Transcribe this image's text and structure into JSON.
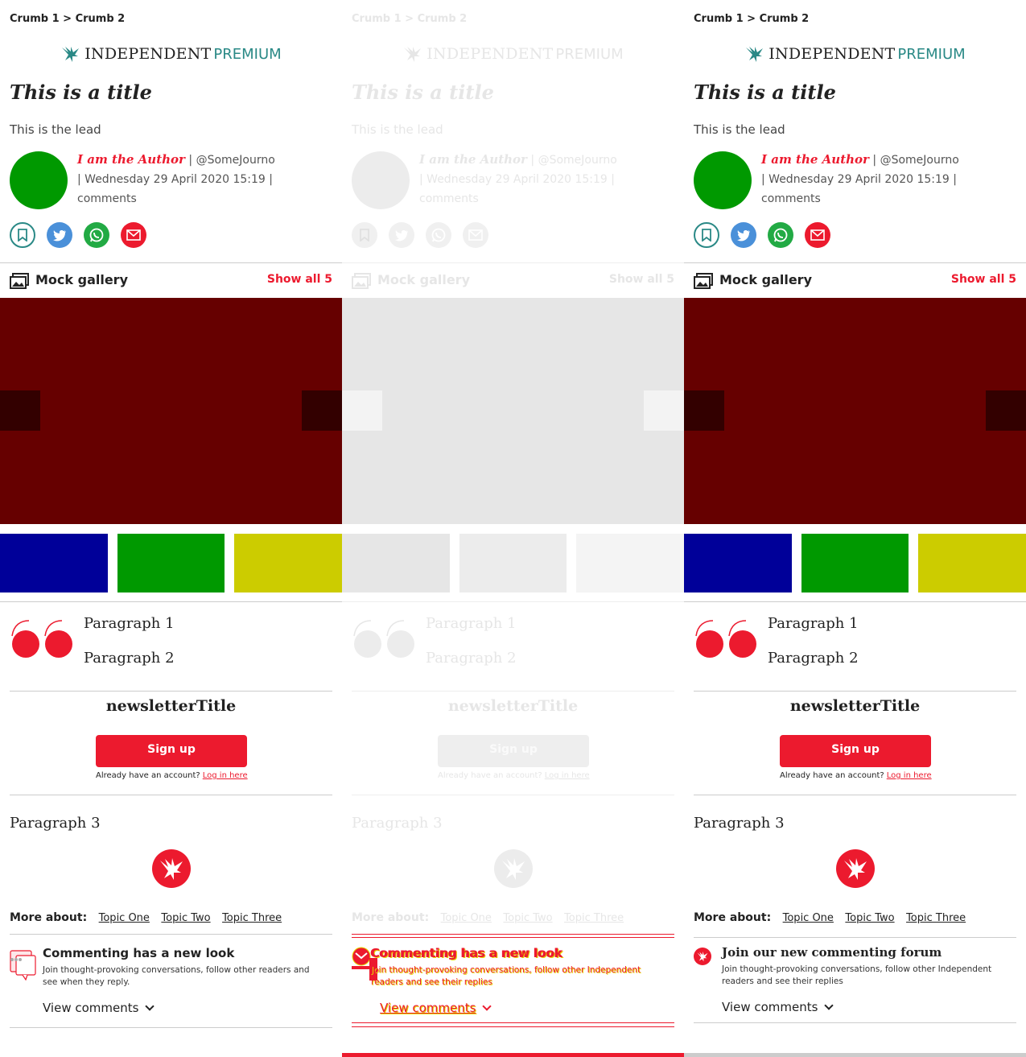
{
  "panels": [
    {
      "breadcrumb": "Crumb 1 > Crumb 2",
      "brand": {
        "name": "INDEPENDENT",
        "tier": "PREMIUM"
      },
      "title": "This is a title",
      "lead": "This is the lead",
      "byline": {
        "author": "I am the Author",
        "handle": "| @SomeJourno",
        "date": "| Wednesday 29 April 2020 15:19 |",
        "comments": "comments"
      },
      "gallery": {
        "title": "Mock gallery",
        "show_all": "Show all 5"
      },
      "paragraphs": [
        "Paragraph 1",
        "Paragraph 2",
        "Paragraph 3"
      ],
      "newsletter": {
        "title": "newsletterTitle",
        "signup": "Sign up",
        "account_text": "Already have an account?",
        "login": "Log in here"
      },
      "more_about": {
        "label": "More about:",
        "topics": [
          "Topic One",
          "Topic Two",
          "Topic Three"
        ]
      },
      "commenting": {
        "title": "Commenting has a new look",
        "desc": "Join thought-provoking conversations, follow other readers and see when they reply.",
        "link": "View comments"
      }
    },
    {
      "breadcrumb": "Crumb 1 > Crumb 2",
      "brand": {
        "name": "INDEPENDENT",
        "tier": "PREMIUM"
      },
      "title": "This is a title",
      "lead": "This is the lead",
      "byline": {
        "author": "I am the Author",
        "handle": "| @SomeJourno",
        "date": "| Wednesday 29 April 2020 15:19 |",
        "comments": "comments"
      },
      "gallery": {
        "title": "Mock gallery",
        "show_all": "Show all 5"
      },
      "paragraphs": [
        "Paragraph 1",
        "Paragraph 2",
        "Paragraph 3"
      ],
      "newsletter": {
        "title": "newsletterTitle",
        "signup": "Sign up",
        "account_text": "Already have an account?",
        "login": "Log in here"
      },
      "more_about": {
        "label": "More about:",
        "topics": [
          "Topic One",
          "Topic Two",
          "Topic Three"
        ]
      },
      "commenting": {
        "title": "Commenting has a new look",
        "desc": "Join thought-provoking conversations, follow other Independent readers and see their replies",
        "link": "View comments"
      }
    },
    {
      "breadcrumb": "Crumb 1 > Crumb 2",
      "brand": {
        "name": "INDEPENDENT",
        "tier": "PREMIUM"
      },
      "title": "This is a title",
      "lead": "This is the lead",
      "byline": {
        "author": "I am the Author",
        "handle": "| @SomeJourno",
        "date": "| Wednesday 29 April 2020 15:19 |",
        "comments": "comments"
      },
      "gallery": {
        "title": "Mock gallery",
        "show_all": "Show all 5"
      },
      "paragraphs": [
        "Paragraph 1",
        "Paragraph 2",
        "Paragraph 3"
      ],
      "newsletter": {
        "title": "newsletterTitle",
        "signup": "Sign up",
        "account_text": "Already have an account?",
        "login": "Log in here"
      },
      "more_about": {
        "label": "More about:",
        "topics": [
          "Topic One",
          "Topic Two",
          "Topic Three"
        ]
      },
      "commenting": {
        "title": "Join our new commenting forum",
        "desc": "Join thought-provoking conversations, follow other Independent readers and see their replies",
        "link": "View comments"
      }
    }
  ],
  "colors": {
    "accent": "#ec1a2e",
    "premium": "#2a8986",
    "gallery_bg": "#660000",
    "avatar": "#009900",
    "diff_marker": "#e6d800"
  },
  "icons": [
    "eagle-icon",
    "bookmark-icon",
    "twitter-icon",
    "whatsapp-icon",
    "email-icon",
    "gallery-icon",
    "quote-icon",
    "chevron-down-icon",
    "comment-bubble-icon"
  ]
}
